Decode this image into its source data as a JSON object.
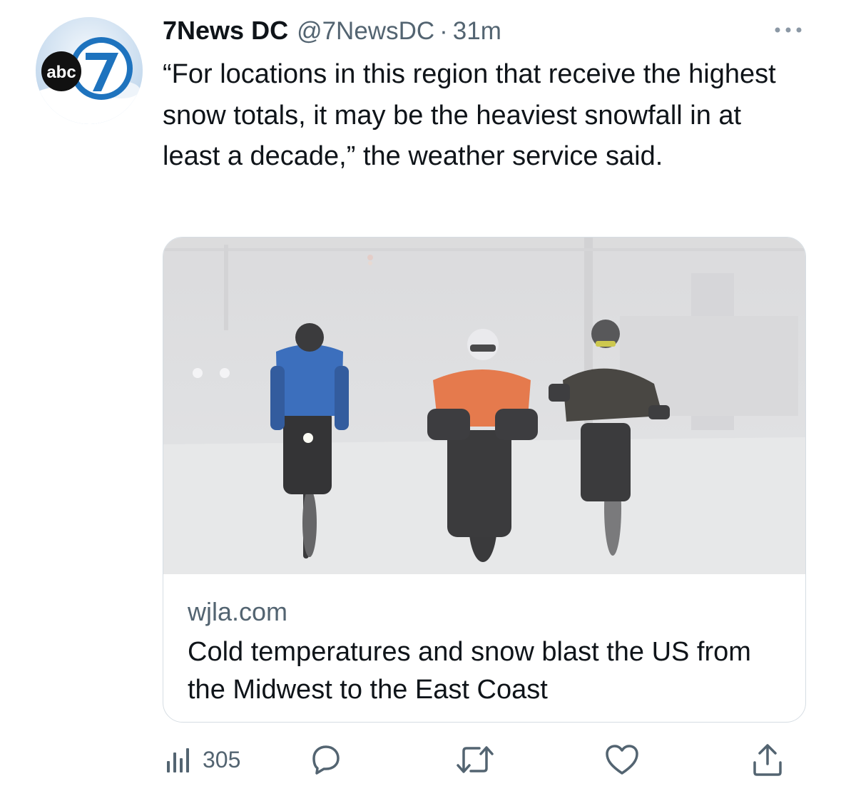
{
  "tweet": {
    "author_name": "7News DC",
    "handle": "@7NewsDC",
    "separator": "·",
    "time": "31m",
    "text": "“For locations in this region that receive the highest snow totals, it may be the heaviest snowfall in at least a decade,” the weather service said."
  },
  "avatar": {
    "logo_text": "abc"
  },
  "card": {
    "domain": "wjla.com",
    "title": "Cold temperatures and snow blast the US from the Midwest to the East Coast"
  },
  "actions": {
    "views_count": "305"
  },
  "colors": {
    "text": "#0f1419",
    "muted": "#536471",
    "border": "#d6dde3",
    "brand_blue": "#1e73be"
  },
  "icons": [
    "more-icon",
    "views-icon",
    "reply-icon",
    "retweet-icon",
    "like-icon",
    "share-icon"
  ]
}
